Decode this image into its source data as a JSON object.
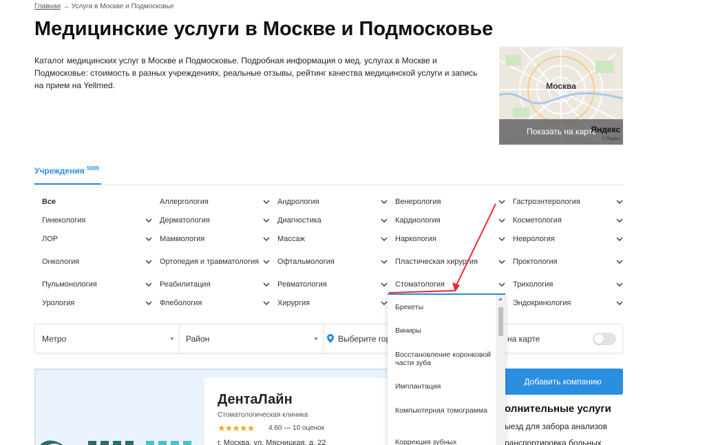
{
  "breadcrumb": {
    "home": "Главная",
    "sep": "→",
    "current": "Услуги в Москве и Подмосковье"
  },
  "title": "Медицинские услуги в Москве и Подмосковье",
  "intro": "Каталог медицинских услуг в Москве и Подмосковье. Подробная информация о мед. услугах в Москве и Подмосковье: стоимость в разных учреждениях, реальные отзывы, рейтинг качества медицинской услуги и запись на прием на Yellmed.",
  "map": {
    "city": "Москва",
    "show_label": "Показать на карте",
    "brand": "Яндекс",
    "copyright": "© Яндекс"
  },
  "tabs": {
    "institutions_label": "Учреждения",
    "institutions_count": "5009"
  },
  "categories": [
    [
      "Все",
      "Аллергология",
      "Андрология",
      "Венерология",
      "Гастроэнтерология"
    ],
    [
      "Гинекология",
      "Дерматология",
      "Диагностика",
      "Кардиология",
      "Косметология"
    ],
    [
      "ЛОР",
      "Маммология",
      "Массаж",
      "Наркология",
      "Неврология"
    ],
    [
      "Онкология",
      "Ортопедия и травматология",
      "Офтальмология",
      "Пластическая хирургия",
      "Проктология"
    ],
    [
      "Пульмонология",
      "Реабилитация",
      "Ревматология",
      "Стоматология",
      "Трихология"
    ],
    [
      "Урология",
      "Флебология",
      "Хирургия",
      "",
      "Эндокринология"
    ]
  ],
  "filters": {
    "metro": "Метро",
    "district": "Район",
    "city_placeholder": "Выберите город",
    "map_toggle": "на карте"
  },
  "dropdown": {
    "items": [
      "Брекеты",
      "Виниры",
      "Восстановление коронковой части зуба",
      "Имплантация",
      "Компьютерная томограмма",
      "Коррекция зубных"
    ]
  },
  "company": {
    "name": "ДентаЛайн",
    "type": "Стоматологическая клиника",
    "stars": "★★★★★",
    "rating": "4.60 — 10 оценок",
    "address": "г. Москва, ул. Мясницкая, д. 22"
  },
  "sidebar": {
    "add_button": "Добавить компанию",
    "services_title": "олнительные услуги",
    "services": [
      "ыезд для забора анализов",
      "ранспортировка больных"
    ]
  },
  "colors": {
    "accent": "#2b8fe0",
    "arrow": "#e8282b"
  }
}
